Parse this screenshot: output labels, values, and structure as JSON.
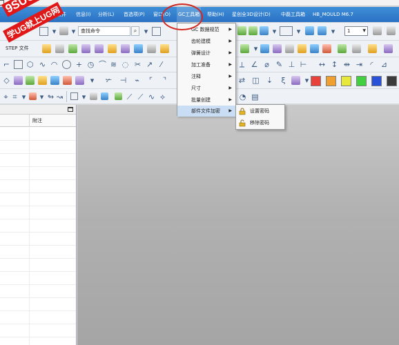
{
  "logo": {
    "line1": "9SUG",
    "line2": "学UG就上UG网"
  },
  "menubar": {
    "items": [
      {
        "label": "优品软件"
      },
      {
        "label": "信息(I)"
      },
      {
        "label": "分析(L)"
      },
      {
        "label": "首选项(P)"
      },
      {
        "label": "窗口(O)"
      },
      {
        "label": "GC工具箱"
      },
      {
        "label": "帮助(H)"
      },
      {
        "label": "星创全3D设计(D)"
      },
      {
        "label": "中磊工具箱"
      },
      {
        "label": "HB_MOULD M6.7"
      }
    ]
  },
  "toolbar": {
    "command_search_value": "查找命令",
    "step_label": "STEP 文件",
    "layer_value": "1"
  },
  "colors": [
    "#e8413a",
    "#f0a030",
    "#e6e83a",
    "#43d040",
    "#2a52d8",
    "#3b3b3b"
  ],
  "navigator": {
    "column_note": "附注"
  },
  "gc_menu": {
    "items": [
      {
        "label": "GC 数据规范"
      },
      {
        "label": "齿轮建模"
      },
      {
        "label": "弹簧设计"
      },
      {
        "label": "加工准备"
      },
      {
        "label": "注释"
      },
      {
        "label": "尺寸"
      },
      {
        "label": "批量创建"
      },
      {
        "label": "部件文件加密"
      }
    ]
  },
  "encryption_submenu": {
    "items": [
      {
        "label": "设置密码",
        "icon": "lock-icon"
      },
      {
        "label": "移除密码",
        "icon": "unlock-icon"
      }
    ]
  }
}
